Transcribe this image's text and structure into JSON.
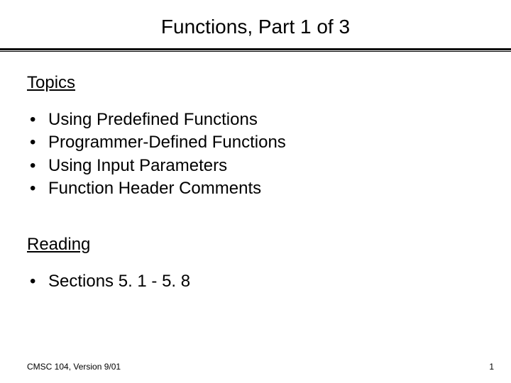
{
  "title": "Functions, Part 1 of 3",
  "sections": {
    "topics": {
      "heading": "Topics",
      "items": [
        "Using Predefined Functions",
        "Programmer-Defined Functions",
        "Using Input Parameters",
        "Function Header Comments"
      ]
    },
    "reading": {
      "heading": "Reading",
      "items": [
        "Sections 5. 1 - 5. 8"
      ]
    }
  },
  "footer": {
    "left": "CMSC 104, Version 9/01",
    "right": "1"
  }
}
